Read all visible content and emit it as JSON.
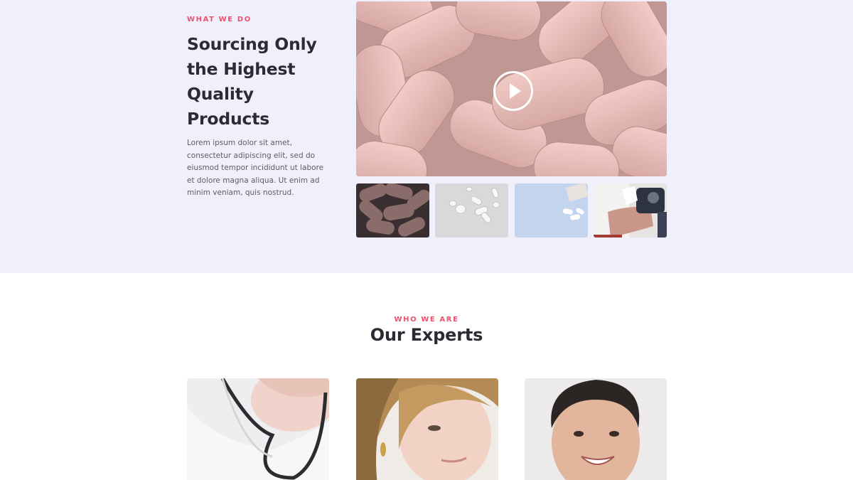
{
  "what_we_do": {
    "eyebrow": "WHAT WE DO",
    "title": "Sourcing Only the Highest Quality Products",
    "body": "Lorem ipsum dolor sit amet, consectetur adipiscing elit, sed do eiusmod tempor incididunt ut labore et dolore magna aliqua. Ut enim ad minim veniam, quis nostrud.",
    "video_icon": "play-icon"
  },
  "who_we_are": {
    "eyebrow": "WHO WE ARE",
    "title": "Our Experts"
  },
  "colors": {
    "accent": "#f0506e",
    "section_bg": "#eff0fb",
    "heading": "#2b2b33",
    "body_text": "#5d5d66"
  }
}
